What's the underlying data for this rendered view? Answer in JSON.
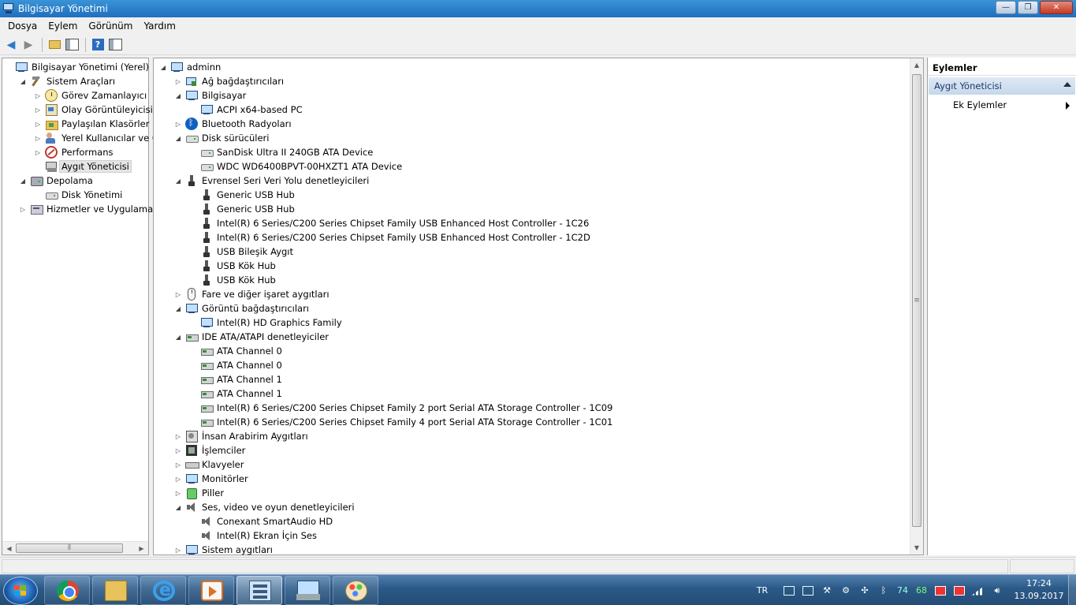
{
  "window": {
    "title": "Bilgisayar Yönetimi",
    "controls": {
      "minimize": "—",
      "maximize": "❐",
      "close": "✕"
    }
  },
  "menu": [
    "Dosya",
    "Eylem",
    "Görünüm",
    "Yardım"
  ],
  "left_tree": [
    {
      "label": "Bilgisayar Yönetimi (Yerel)",
      "icon": "computer-icon",
      "level": 0,
      "expander": ""
    },
    {
      "label": "Sistem Araçları",
      "icon": "tools-icon",
      "level": 1,
      "expander": "open"
    },
    {
      "label": "Görev Zamanlayıcı",
      "icon": "clock-icon",
      "level": 2,
      "expander": "closed"
    },
    {
      "label": "Olay Görüntüleyicisi",
      "icon": "event-viewer-icon",
      "level": 2,
      "expander": "closed"
    },
    {
      "label": "Paylaşılan Klasörler",
      "icon": "shared-folder-icon",
      "level": 2,
      "expander": "closed"
    },
    {
      "label": "Yerel Kullanıcılar ve Gru",
      "icon": "users-icon",
      "level": 2,
      "expander": "closed"
    },
    {
      "label": "Performans",
      "icon": "performance-icon",
      "level": 2,
      "expander": "closed"
    },
    {
      "label": "Aygıt Yöneticisi",
      "icon": "device-manager-icon",
      "level": 2,
      "expander": "",
      "selected": true
    },
    {
      "label": "Depolama",
      "icon": "storage-icon",
      "level": 1,
      "expander": "open"
    },
    {
      "label": "Disk Yönetimi",
      "icon": "disk-icon",
      "level": 2,
      "expander": ""
    },
    {
      "label": "Hizmetler ve Uygulamalar",
      "icon": "services-icon",
      "level": 1,
      "expander": "closed"
    }
  ],
  "device_tree": [
    {
      "label": "adminn",
      "icon": "computer-icon",
      "level": 0,
      "expander": "open"
    },
    {
      "label": "Ağ bağdaştırıcıları",
      "icon": "network-adapter-icon",
      "level": 1,
      "expander": "closed"
    },
    {
      "label": "Bilgisayar",
      "icon": "computer-icon",
      "level": 1,
      "expander": "open"
    },
    {
      "label": "ACPI x64-based PC",
      "icon": "computer-icon",
      "level": 2,
      "expander": ""
    },
    {
      "label": "Bluetooth Radyoları",
      "icon": "bluetooth-icon",
      "level": 1,
      "expander": "closed"
    },
    {
      "label": "Disk sürücüleri",
      "icon": "disk-icon",
      "level": 1,
      "expander": "open"
    },
    {
      "label": "SanDisk Ultra II 240GB ATA Device",
      "icon": "disk-icon",
      "level": 2,
      "expander": ""
    },
    {
      "label": "WDC WD6400BPVT-00HXZT1 ATA Device",
      "icon": "disk-icon",
      "level": 2,
      "expander": ""
    },
    {
      "label": "Evrensel Seri Veri Yolu denetleyicileri",
      "icon": "usb-icon",
      "level": 1,
      "expander": "open"
    },
    {
      "label": "Generic USB Hub",
      "icon": "usb-icon",
      "level": 2,
      "expander": ""
    },
    {
      "label": "Generic USB Hub",
      "icon": "usb-icon",
      "level": 2,
      "expander": ""
    },
    {
      "label": "Intel(R) 6 Series/C200 Series Chipset Family USB Enhanced Host Controller - 1C26",
      "icon": "usb-icon",
      "level": 2,
      "expander": ""
    },
    {
      "label": "Intel(R) 6 Series/C200 Series Chipset Family USB Enhanced Host Controller - 1C2D",
      "icon": "usb-icon",
      "level": 2,
      "expander": ""
    },
    {
      "label": "USB Bileşik Aygıt",
      "icon": "usb-icon",
      "level": 2,
      "expander": ""
    },
    {
      "label": "USB Kök Hub",
      "icon": "usb-icon",
      "level": 2,
      "expander": ""
    },
    {
      "label": "USB Kök Hub",
      "icon": "usb-icon",
      "level": 2,
      "expander": ""
    },
    {
      "label": "Fare ve diğer işaret aygıtları",
      "icon": "mouse-icon",
      "level": 1,
      "expander": "closed"
    },
    {
      "label": "Görüntü bağdaştırıcıları",
      "icon": "display-adapter-icon",
      "level": 1,
      "expander": "open"
    },
    {
      "label": "Intel(R) HD Graphics Family",
      "icon": "display-adapter-icon",
      "level": 2,
      "expander": ""
    },
    {
      "label": "IDE ATA/ATAPI denetleyiciler",
      "icon": "ide-controller-icon",
      "level": 1,
      "expander": "open"
    },
    {
      "label": "ATA Channel 0",
      "icon": "ide-controller-icon",
      "level": 2,
      "expander": ""
    },
    {
      "label": "ATA Channel 0",
      "icon": "ide-controller-icon",
      "level": 2,
      "expander": ""
    },
    {
      "label": "ATA Channel 1",
      "icon": "ide-controller-icon",
      "level": 2,
      "expander": ""
    },
    {
      "label": "ATA Channel 1",
      "icon": "ide-controller-icon",
      "level": 2,
      "expander": ""
    },
    {
      "label": "Intel(R) 6 Series/C200 Series Chipset Family 2 port Serial ATA Storage Controller - 1C09",
      "icon": "ide-controller-icon",
      "level": 2,
      "expander": ""
    },
    {
      "label": "Intel(R) 6 Series/C200 Series Chipset Family 4 port Serial ATA Storage Controller - 1C01",
      "icon": "ide-controller-icon",
      "level": 2,
      "expander": ""
    },
    {
      "label": "İnsan Arabirim Aygıtları",
      "icon": "hid-icon",
      "level": 1,
      "expander": "closed"
    },
    {
      "label": "İşlemciler",
      "icon": "processor-icon",
      "level": 1,
      "expander": "closed"
    },
    {
      "label": "Klavyeler",
      "icon": "keyboard-icon",
      "level": 1,
      "expander": "closed"
    },
    {
      "label": "Monitörler",
      "icon": "monitor-icon",
      "level": 1,
      "expander": "closed"
    },
    {
      "label": "Piller",
      "icon": "battery-icon",
      "level": 1,
      "expander": "closed"
    },
    {
      "label": "Ses, video ve oyun denetleyicileri",
      "icon": "sound-icon",
      "level": 1,
      "expander": "open"
    },
    {
      "label": "Conexant SmartAudio HD",
      "icon": "sound-icon",
      "level": 2,
      "expander": ""
    },
    {
      "label": "Intel(R) Ekran İçin Ses",
      "icon": "sound-icon",
      "level": 2,
      "expander": ""
    },
    {
      "label": "Sistem aygıtları",
      "icon": "system-devices-icon",
      "level": 1,
      "expander": "closed"
    }
  ],
  "actions": {
    "header": "Eylemler",
    "section": "Aygıt Yöneticisi",
    "item": "Ek Eylemler"
  },
  "taskbar": {
    "apps": [
      {
        "name": "chrome",
        "icon": "chrome-icon",
        "active": false
      },
      {
        "name": "explorer",
        "icon": "folder-icon",
        "active": false
      },
      {
        "name": "ie",
        "icon": "internet-explorer-icon",
        "active": false
      },
      {
        "name": "media",
        "icon": "media-player-icon",
        "active": false
      },
      {
        "name": "computer-management",
        "icon": "computer-management-icon",
        "active": true
      },
      {
        "name": "device-manager",
        "icon": "device-manager-icon",
        "active": false
      },
      {
        "name": "paint",
        "icon": "paint-icon",
        "active": false
      }
    ],
    "tray": {
      "language": "TR",
      "temp1": "74",
      "temp2": "68"
    },
    "clock": {
      "time": "17:24",
      "date": "13.09.2017"
    }
  }
}
